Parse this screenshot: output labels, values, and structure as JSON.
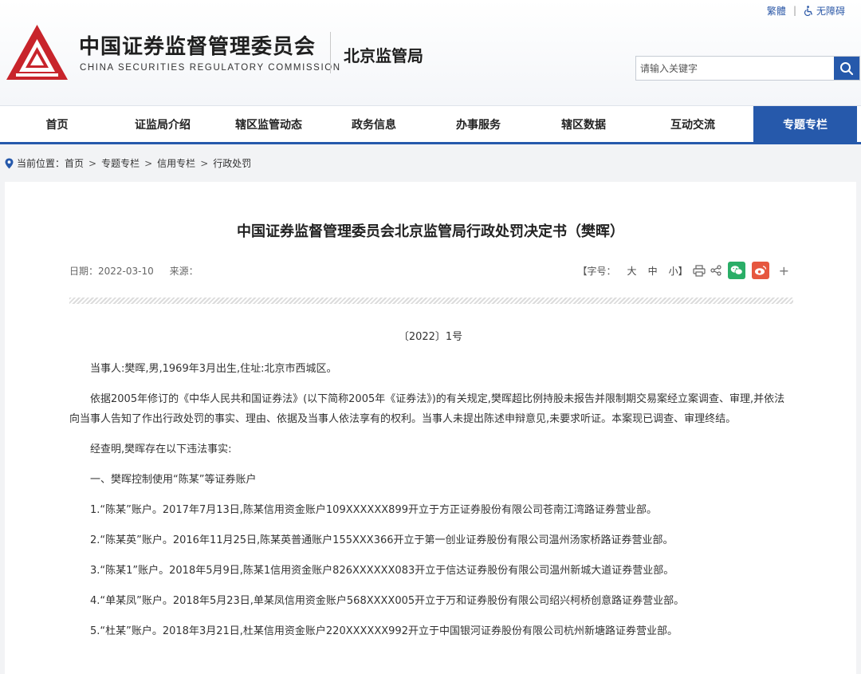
{
  "header": {
    "top_links": {
      "traditional": "繁體",
      "accessibility": "无障碍"
    },
    "org_name_cn": "中国证券监督管理委员会",
    "org_name_en": "CHINA SECURITIES REGULATORY COMMISSION",
    "bureau": "北京监管局",
    "search": {
      "placeholder": "请输入关键字"
    },
    "logo_color": "#c8242b"
  },
  "nav": {
    "items": [
      {
        "label": "首页"
      },
      {
        "label": "证监局介绍"
      },
      {
        "label": "辖区监管动态"
      },
      {
        "label": "政务信息"
      },
      {
        "label": "办事服务"
      },
      {
        "label": "辖区数据"
      },
      {
        "label": "互动交流"
      },
      {
        "label": "专题专栏",
        "active": true
      }
    ],
    "accent_color": "#2659ab"
  },
  "breadcrumb": {
    "prefix": "当前位置：",
    "items": [
      "首页",
      "专题专栏",
      "信用专栏",
      "行政处罚"
    ]
  },
  "article": {
    "title": "中国证券监督管理委员会北京监管局行政处罚决定书（樊晖）",
    "date": "日期：2022-03-10",
    "source": "来源：",
    "font_size_label": "【字号：",
    "font_sizes": [
      "大",
      "中",
      "小】"
    ],
    "doc_number": "〔2022〕1号",
    "paragraphs": [
      "当事人:樊晖,男,1969年3月出生,住址:北京市西城区。",
      "依据2005年修订的《中华人民共和国证券法》(以下简称2005年《证券法》)的有关规定,樊晖超比例持股未报告并限制期交易案经立案调查、审理,并依法向当事人告知了作出行政处罚的事实、理由、依据及当事人依法享有的权利。当事人未提出陈述申辩意见,未要求听证。本案现已调查、审理终结。",
      "经查明,樊晖存在以下违法事实:",
      "一、樊晖控制使用“陈某”等证券账户",
      "1.“陈某”账户。2017年7月13日,陈某信用资金账户109XXXXXX899开立于方正证券股份有限公司苍南江湾路证券营业部。",
      "2.“陈某英”账户。2016年11月25日,陈某英普通账户155XXX366开立于第一创业证券股份有限公司温州汤家桥路证券营业部。",
      "3.“陈某1”账户。2018年5月9日,陈某1信用资金账户826XXXXXX083开立于信达证券股份有限公司温州新城大道证券营业部。",
      "4.“单某凤”账户。2018年5月23日,单某凤信用资金账户568XXXX005开立于万和证券股份有限公司绍兴柯桥创意路证券营业部。",
      "5.“杜某”账户。2018年3月21日,杜某信用资金账户220XXXXXX992开立于中国银河证券股份有限公司杭州新塘路证券营业部。"
    ]
  },
  "icons": {
    "share": [
      "printer-icon",
      "share-icon",
      "wechat-icon",
      "weibo-icon",
      "plus-icon"
    ],
    "wechat_color": "#2aae67",
    "weibo_color": "#e6573f"
  }
}
